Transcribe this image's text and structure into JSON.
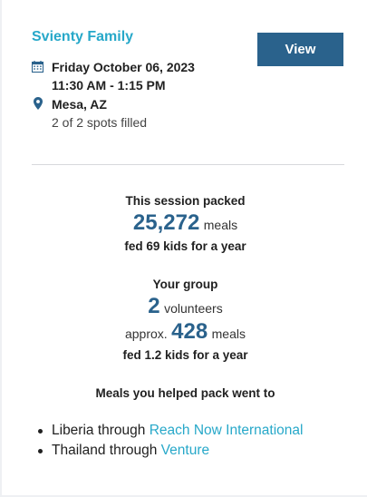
{
  "event": {
    "family_name": "Svienty Family",
    "view_button_label": "View",
    "date": "Friday October 06, 2023",
    "time": "11:30 AM - 1:15 PM",
    "location": "Mesa, AZ",
    "spots": "2 of 2 spots filled"
  },
  "session": {
    "heading": "This session packed",
    "meals_count": "25,272",
    "meals_unit": "meals",
    "fed_text": "fed 69 kids for a year"
  },
  "group": {
    "heading": "Your group",
    "volunteers_count": "2",
    "volunteers_unit": "volunteers",
    "approx_prefix": "approx.",
    "meals_count": "428",
    "meals_unit": "meals",
    "fed_text": "fed 1.2 kids for a year"
  },
  "destinations": {
    "heading": "Meals you helped pack went to",
    "items": [
      {
        "country": "Liberia",
        "through": "through",
        "partner": "Reach Now International"
      },
      {
        "country": "Thailand",
        "through": "through",
        "partner": "Venture"
      }
    ]
  },
  "colors": {
    "accent": "#27a8c9",
    "primary": "#2a628c"
  },
  "icons": {
    "date": "calendar-icon",
    "location": "map-pin-icon"
  }
}
